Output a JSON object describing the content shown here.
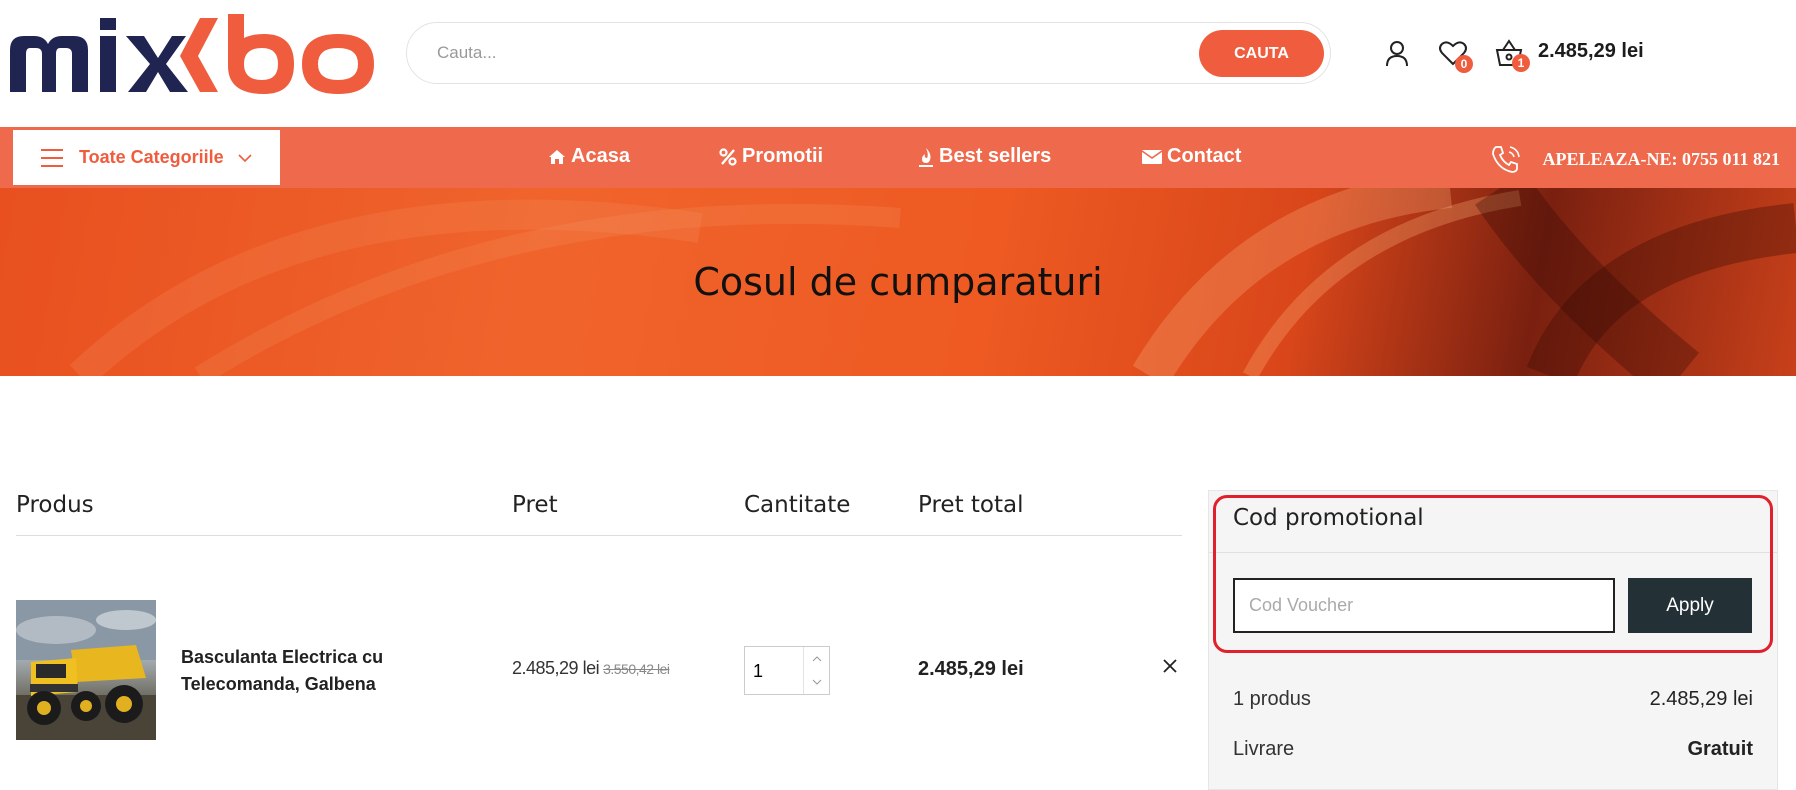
{
  "header": {
    "logo_alt": "mixbo",
    "search": {
      "placeholder": "Cauta...",
      "button_label": "CAUTA"
    },
    "wishlist_count": "0",
    "cart_count": "1",
    "cart_total": "2.485,29 lei"
  },
  "nav": {
    "categories_label": "Toate Categoriile",
    "links": [
      {
        "label": "Acasa",
        "icon": "home-icon"
      },
      {
        "label": "Promotii",
        "icon": "percent-icon"
      },
      {
        "label": "Best sellers",
        "icon": "fire-icon"
      },
      {
        "label": "Contact",
        "icon": "envelope-icon"
      }
    ],
    "phone_label": "APELEAZA-NE: 0755 011 821"
  },
  "banner": {
    "title": "Cosul de cumparaturi"
  },
  "cart_table": {
    "headers": {
      "product": "Produs",
      "price": "Pret",
      "quantity": "Cantitate",
      "total": "Pret total"
    },
    "items": [
      {
        "name": "Basculanta Electrica cu Telecomanda, Galbena",
        "price": "2.485,29 lei",
        "old_price": "3.550,42 lei",
        "quantity": "1",
        "total": "2.485,29 lei"
      }
    ]
  },
  "sidebar": {
    "promo_title": "Cod promotional",
    "voucher_placeholder": "Cod Voucher",
    "apply_label": "Apply",
    "summary": [
      {
        "label": "1 produs",
        "value": "2.485,29 lei"
      },
      {
        "label": "Livrare",
        "value": "Gratuit"
      }
    ]
  },
  "colors": {
    "accent": "#ef5d3e",
    "navy": "#1f2451",
    "dark_button": "#233035",
    "highlight": "#e0202c"
  }
}
